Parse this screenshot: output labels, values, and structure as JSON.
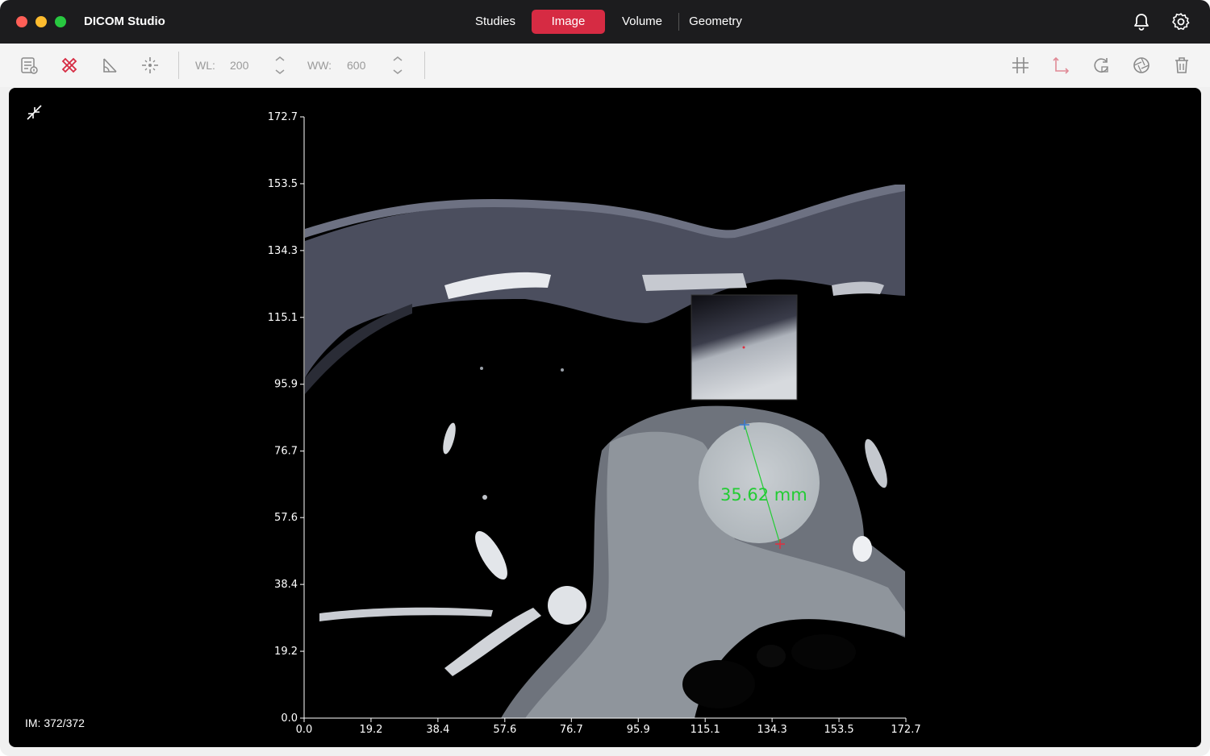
{
  "app": {
    "title": "DICOM Studio"
  },
  "nav": {
    "studies": "Studies",
    "image": "Image",
    "volume": "Volume",
    "geometry": "Geometry"
  },
  "toolbar": {
    "wl_label": "WL:",
    "wl_value": "200",
    "ww_label": "WW:",
    "ww_value": "600"
  },
  "viewer": {
    "image_counter": "IM: 372/372",
    "measurement": "35.62 mm"
  },
  "chart_data": {
    "type": "scatter",
    "x_ticks": [
      "0.0",
      "19.2",
      "38.4",
      "57.6",
      "76.7",
      "95.9",
      "115.1",
      "134.3",
      "153.5",
      "172.7"
    ],
    "y_ticks": [
      "0.0",
      "19.2",
      "38.4",
      "57.6",
      "76.7",
      "95.9",
      "115.1",
      "134.3",
      "153.5",
      "172.7"
    ],
    "xlim": [
      0,
      172.7
    ],
    "ylim": [
      0,
      172.7
    ],
    "colors": {
      "accent": "#d62b43",
      "measurement": "#22cc33"
    }
  }
}
